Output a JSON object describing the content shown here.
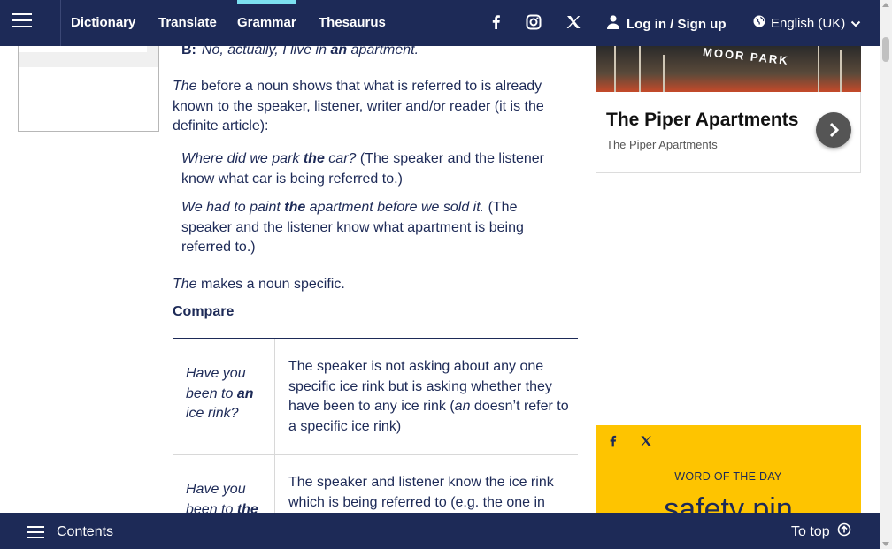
{
  "nav": {
    "links": [
      "Dictionary",
      "Translate",
      "Grammar",
      "Thesaurus"
    ],
    "active": "Grammar",
    "login": "Log in / Sign up",
    "language": "English (UK)"
  },
  "content": {
    "b_label": "B:",
    "b_text_1": "No, actually, I live in ",
    "b_text_bold": "an",
    "b_text_2": " apartment.",
    "para1_em": "The",
    "para1_rest": " before a noun shows that what is referred to is already known to the speaker, listener, writer and/or reader (it is the definite article):",
    "ex1_em_1": "Where did we park ",
    "ex1_bold": "the",
    "ex1_em_2": " car?",
    "ex1_rest": " (The speaker and the listener know what car is being referred to.)",
    "ex2_em_1": "We had to paint ",
    "ex2_bold": "the",
    "ex2_em_2": " apartment before we sold it.",
    "ex2_rest": " (The speaker and the listener know what apartment is being referred to.)",
    "para2_em": "The",
    "para2_rest": " makes a noun specific.",
    "compare": "Compare"
  },
  "table": {
    "row1": {
      "left_em_1": "Have you been to ",
      "left_bold": "an",
      "left_em_2": " ice rink?",
      "right_1": "The speaker is not asking about any one specific ice rink but is asking whether they have been to any ice rink (",
      "right_em": "an",
      "right_2": " doesn’t refer to a specific ice rink)"
    },
    "row2": {
      "left_em_1": "Have you been to ",
      "left_bold": "the",
      "right": "The speaker and listener know the ice rink which is being referred to (e.g. the one in"
    }
  },
  "ad": {
    "sign": "MOOR PARK",
    "title": "The Piper Apartments",
    "subtitle": "The Piper Apartments"
  },
  "wotd": {
    "label": "WORD OF THE DAY",
    "word": "safety pin"
  },
  "bottom": {
    "contents": "Contents",
    "totop": "To top"
  },
  "colors": {
    "navy": "#1d2a57",
    "accent": "#7ce0f0",
    "wotd_bg": "#fec400"
  }
}
